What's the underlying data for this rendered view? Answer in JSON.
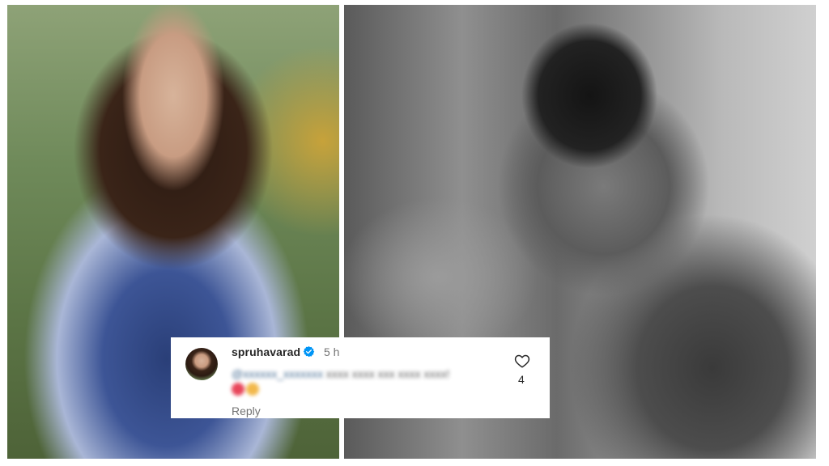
{
  "images": {
    "left_photo": "photo-woman-outdoors",
    "right_photo": "photo-man-black-and-white"
  },
  "comment": {
    "username": "spruhavarad",
    "verified": true,
    "timestamp": "5 h",
    "text_blurred": true,
    "reply_label": "Reply",
    "like_count": "4",
    "icons": {
      "verified": "verified-badge-icon",
      "like": "heart-icon"
    }
  },
  "colors": {
    "verified_blue": "#0095f6",
    "text_primary": "#262626",
    "text_secondary": "#737373"
  }
}
